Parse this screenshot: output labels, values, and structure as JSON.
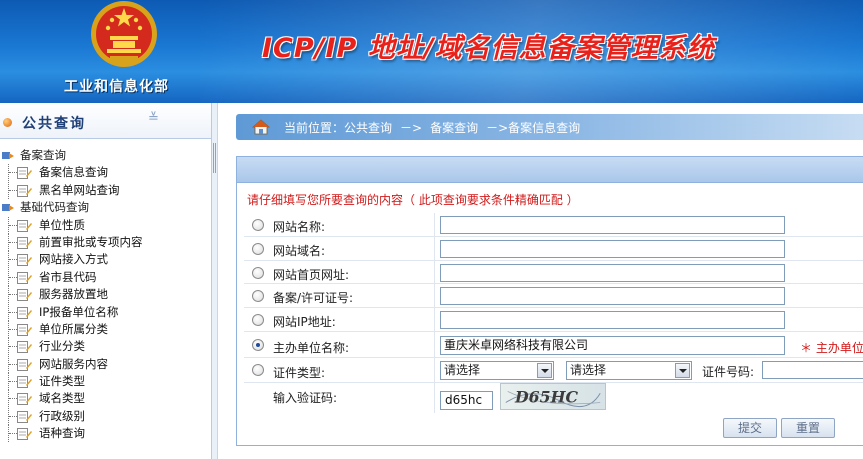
{
  "header": {
    "ministry": "工业和信息化部",
    "system_title": "ICP/IP 地址/域名信息备案管理系统"
  },
  "sidebar": {
    "title": "公共查询",
    "groups": [
      {
        "label": "备案查询",
        "items": [
          "备案信息查询",
          "黑名单网站查询"
        ]
      },
      {
        "label": "基础代码查询",
        "items": [
          "单位性质",
          "前置审批或专项内容",
          "网站接入方式",
          "省市县代码",
          "服务器放置地",
          "IP报备单位名称",
          "单位所属分类",
          "行业分类",
          "网站服务内容",
          "证件类型",
          "域名类型",
          "行政级别",
          "语种查询"
        ]
      }
    ]
  },
  "breadcrumb": {
    "prefix": "当前位置：",
    "path": [
      "公共查询",
      "－>",
      "备案查询",
      "－>备案信息查询"
    ]
  },
  "form": {
    "notice": "请仔细填写您所要查询的内容（ 此项查询要求条件精确匹配 ）",
    "fields": [
      {
        "label": "网站名称:",
        "value": ""
      },
      {
        "label": "网站域名:",
        "value": ""
      },
      {
        "label": "网站首页网址:",
        "value": ""
      },
      {
        "label": "备案/许可证号:",
        "value": ""
      },
      {
        "label": "网站IP地址:",
        "value": ""
      },
      {
        "label": "主办单位名称:",
        "value": "重庆米卓网络科技有限公司"
      }
    ],
    "required_note": "＊ 主办单位名称",
    "cert_type_label": "证件类型:",
    "cert_select_1": "请选择",
    "cert_select_2": "请选择",
    "cert_no_label": "证件号码:",
    "captcha_label": "输入验证码:",
    "captcha_value": "d65hc",
    "captcha_text": "D65HC",
    "submit_label": "提交",
    "reset_label": "重置"
  }
}
